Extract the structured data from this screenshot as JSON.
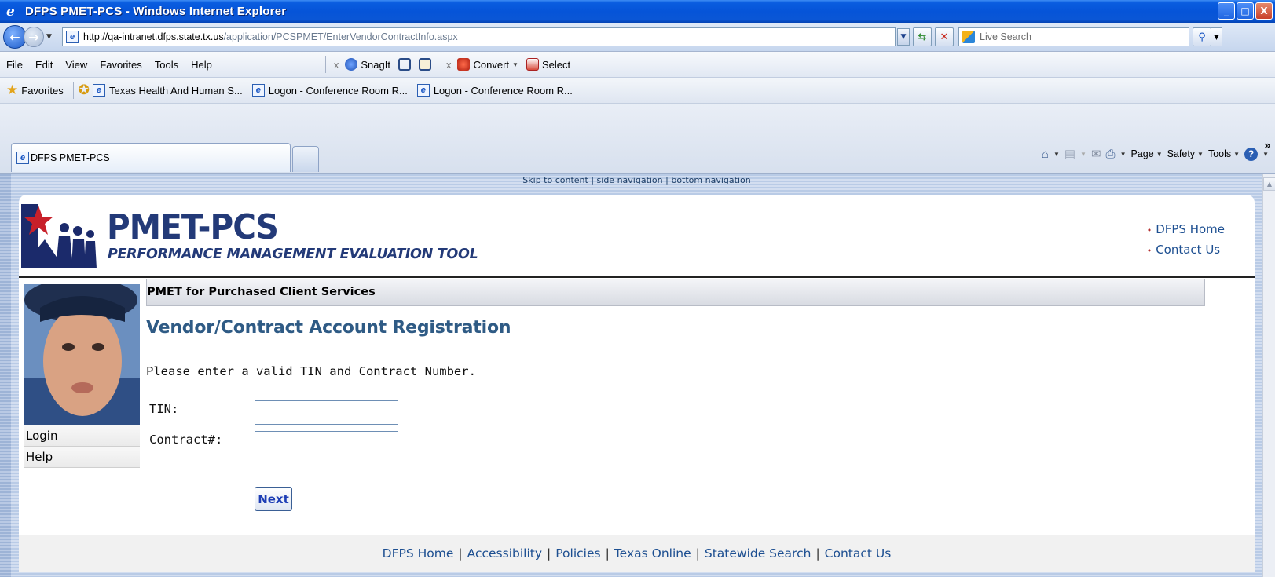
{
  "window": {
    "title": "DFPS PMET-PCS - Windows Internet Explorer",
    "controls": {
      "minimize": "_",
      "maximize": "□",
      "close": "X"
    }
  },
  "address_bar": {
    "url_host": "http://qa-intranet.dfps.state.tx.us",
    "url_path": "/application/PCSPMET/EnterVendorContractInfo.aspx",
    "search_placeholder": "Live Search"
  },
  "menu": {
    "items": [
      "File",
      "Edit",
      "View",
      "Favorites",
      "Tools",
      "Help"
    ],
    "toolbar": {
      "snagit_label": "SnagIt",
      "convert_label": "Convert",
      "select_label": "Select"
    }
  },
  "favorites_bar": {
    "favorites_label": "Favorites",
    "links": [
      "Texas Health And Human S...",
      "Logon - Conference Room R...",
      "Logon - Conference Room R..."
    ]
  },
  "tabs": {
    "active": "DFPS PMET-PCS"
  },
  "command_bar": {
    "page": "Page",
    "safety": "Safety",
    "tools": "Tools"
  },
  "skip_links": {
    "content": "Skip to content",
    "side": "side navigation",
    "bottom": "bottom navigation"
  },
  "site": {
    "logo_title": "PMET-PCS",
    "logo_subtitle": "PERFORMANCE MANAGEMENT EVALUATION TOOL",
    "top_links": [
      "DFPS Home",
      "Contact Us"
    ]
  },
  "sidebar": {
    "items": [
      "Login",
      "Help"
    ]
  },
  "main": {
    "breadcrumb": "PMET for Purchased Client Services",
    "heading": "Vendor/Contract Account Registration",
    "instructions": "Please enter a valid TIN and Contract Number.",
    "tin_label": "TIN:",
    "tin_value": "",
    "contract_label": "Contract#:",
    "contract_value": "",
    "next_label": "Next"
  },
  "footer": {
    "links": [
      "DFPS Home",
      "Accessibility",
      "Policies",
      "Texas Online",
      "Statewide Search",
      "Contact Us"
    ]
  },
  "colors": {
    "title_bar": "#0654d8",
    "heading": "#2f5b85",
    "link": "#1d4f91",
    "logo": "#233a78"
  }
}
